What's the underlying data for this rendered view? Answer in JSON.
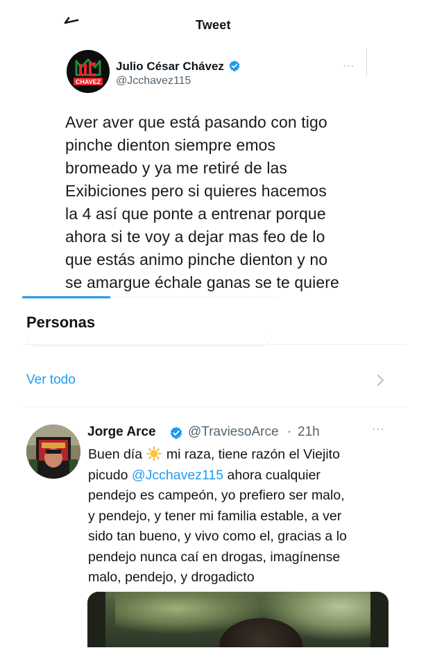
{
  "header": {
    "title": "Tweet"
  },
  "main_tweet": {
    "author_name": "Julio César Chávez",
    "author_handle": "@Jcchavez115",
    "avatar_logo_text": "CHAVEZ",
    "more_label": "···",
    "body_lines": [
      "Aver aver que está pasando con tigo",
      "pinche dienton siempre emos",
      "bromeado y ya me retiré de las",
      "Exibiciones pero si quieres hacemos",
      "la 4 así que ponte a entrenar porque",
      "ahora si te voy a dejar mas feo de lo",
      "que estás animo pinche dienton y no",
      "se amargue échale ganas se te quiere"
    ]
  },
  "personas": {
    "title": "Personas",
    "see_all_label": "Ver todo"
  },
  "reply_tweet": {
    "author_name": "Jorge Arce",
    "author_handle": "@TraviesoArce",
    "separator": "·",
    "time": "21h",
    "more_label": "···",
    "body": {
      "line1_before": "Buen día ",
      "line1_after": " mi raza, tiene razón el Viejito",
      "line2_before": "picudo ",
      "line2_mention": "@Jcchavez115",
      "line2_after": " ahora cualquier",
      "line3": "pendejo es campeón, yo prefiero ser malo,",
      "line4": "y pendejo, y tener mi familia estable, a ver",
      "line5": "sido tan bueno, y vivo como el, gracias a lo",
      "line6": "pendejo nunca caí en drogas, imagínense",
      "line7": "malo, pendejo, y drogadicto"
    }
  },
  "icons": {
    "back": "arrow-left-icon",
    "verified": "verified-badge-icon",
    "chevron": "chevron-right-icon",
    "sun": "sun-emoji"
  },
  "colors": {
    "accent": "#1d9bf0",
    "secondary_text": "#536471",
    "divider": "#eff3f4",
    "logo_red": "#e4252b",
    "logo_green": "#1e8d3a"
  }
}
